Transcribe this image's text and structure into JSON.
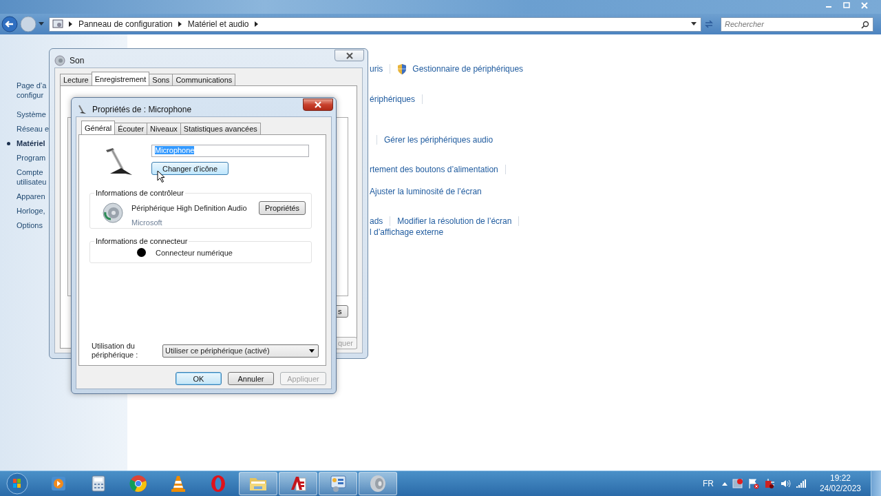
{
  "explorer": {
    "breadcrumbs": [
      "Panneau de configuration",
      "Matériel et audio"
    ],
    "search": {
      "placeholder": "Rechercher"
    }
  },
  "sidebar": {
    "items": [
      {
        "lines": [
          "Page d’a",
          "configur"
        ],
        "selected": false
      },
      {
        "lines": [
          "Système"
        ],
        "selected": false
      },
      {
        "lines": [
          "Réseau e"
        ],
        "selected": false
      },
      {
        "lines": [
          "Matériel"
        ],
        "selected": true
      },
      {
        "lines": [
          "Program"
        ],
        "selected": false
      },
      {
        "lines": [
          "Compte",
          "utilisateu"
        ],
        "selected": false
      },
      {
        "lines": [
          "Apparen"
        ],
        "selected": false
      },
      {
        "lines": [
          "Horloge,"
        ],
        "selected": false
      },
      {
        "lines": [
          "Options"
        ],
        "selected": false
      }
    ]
  },
  "content_rows": [
    {
      "items": [
        {
          "kind": "link",
          "text": "uris"
        },
        {
          "kind": "separator"
        },
        {
          "kind": "shield_link",
          "text": "Gestionnaire de périphériques"
        }
      ]
    },
    {
      "items": [
        {
          "kind": "link",
          "text": "ériphériques"
        },
        {
          "kind": "separator"
        }
      ]
    },
    {
      "items": [
        {
          "kind": "separator"
        },
        {
          "kind": "link",
          "text": "Gérer les périphériques audio"
        }
      ]
    },
    {
      "items": [
        {
          "kind": "link",
          "text": "rtement des boutons d’alimentation"
        },
        {
          "kind": "separator"
        }
      ]
    },
    {
      "items": [
        {
          "kind": "link",
          "text": "Ajuster la luminosité de l’écran"
        }
      ]
    },
    {
      "items": [
        {
          "kind": "link",
          "text": "ads"
        },
        {
          "kind": "separator"
        },
        {
          "kind": "link",
          "text": "Modifier la résolution de l’écran"
        },
        {
          "kind": "separator"
        }
      ]
    },
    {
      "items": [
        {
          "kind": "link",
          "text": "l d’affichage externe"
        }
      ]
    }
  ],
  "son_window": {
    "title": "Son",
    "tabs": [
      {
        "label": "Lecture",
        "selected": false
      },
      {
        "label": "Enregistrement",
        "selected": true
      },
      {
        "label": "Sons",
        "selected": false
      },
      {
        "label": "Communications",
        "selected": false
      }
    ],
    "side_button": "s",
    "apply_button": {
      "label": "quer",
      "disabled": true
    }
  },
  "dialog": {
    "title": "Propriétés de : Microphone",
    "tabs": [
      {
        "label": "Général",
        "selected": true
      },
      {
        "label": "Écouter",
        "selected": false
      },
      {
        "label": "Niveaux",
        "selected": false
      },
      {
        "label": "Statistiques avancées",
        "selected": false
      }
    ],
    "name_field": {
      "value": "Microphone",
      "text_selected": true
    },
    "change_icon_button": {
      "label": "Changer d’icône",
      "hovered": true
    },
    "controller_group": {
      "label": "Informations de contrôleur",
      "device": "Périphérique High Definition Audio",
      "vendor": "Microsoft",
      "button": "Propriétés"
    },
    "connector_group": {
      "label": "Informations de connecteur",
      "connector": "Connecteur numérique",
      "color": "#000000"
    },
    "usage": {
      "label": "Utilisation du périphérique :",
      "value": "Utiliser ce périphérique (activé)"
    },
    "buttons": [
      {
        "label": "OK",
        "default": true,
        "disabled": false
      },
      {
        "label": "Annuler",
        "default": false,
        "disabled": false
      },
      {
        "label": "Appliquer",
        "default": false,
        "disabled": true
      }
    ]
  },
  "taskbar": {
    "items": [
      {
        "kind": "media",
        "running": false
      },
      {
        "kind": "calculator",
        "running": false
      },
      {
        "kind": "browser",
        "running": false
      },
      {
        "kind": "cone",
        "running": false
      },
      {
        "kind": "ring",
        "running": false
      },
      {
        "kind": "folder",
        "running": true
      },
      {
        "kind": "cad",
        "running": true
      },
      {
        "kind": "panel",
        "running": true
      },
      {
        "kind": "speaker",
        "running": true
      }
    ],
    "language": "FR",
    "time": "19:22",
    "date": "24/02/2023"
  }
}
